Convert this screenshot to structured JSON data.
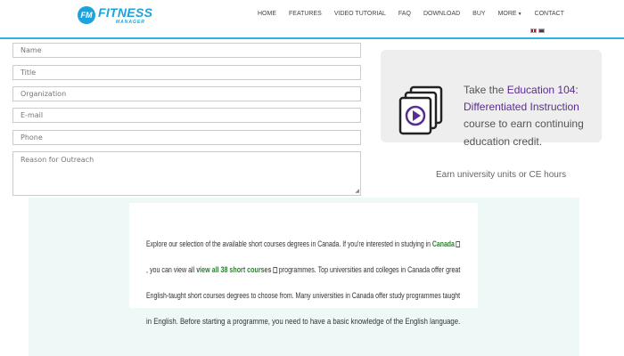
{
  "brand": {
    "badge": "FM",
    "name": "FITNESS",
    "sub": "MANAGER"
  },
  "nav": [
    {
      "label": "HOME"
    },
    {
      "label": "FEATURES"
    },
    {
      "label": "VIDEO TUTORIAL"
    },
    {
      "label": "FAQ"
    },
    {
      "label": "DOWNLOAD"
    },
    {
      "label": "BUY"
    },
    {
      "label": "MORE",
      "has_dropdown": true
    },
    {
      "label": "CONTACT"
    }
  ],
  "form": {
    "name_placeholder": "Name",
    "title_placeholder": "Title",
    "organization_placeholder": "Organization",
    "email_placeholder": "E-mail",
    "phone_placeholder": "Phone",
    "reason_placeholder": "Reason for Outreach"
  },
  "promo": {
    "text_pre": "Take the ",
    "link": "Education 104: Differentiated Instruction",
    "text_post": " course to earn continuing education credit.",
    "note": "Earn university units or CE hours"
  },
  "info": {
    "line1_pre": "Explore our selection of the available short courses degrees in Canada. If you're interested in studying in ",
    "line1_link": "Canada",
    "line2_pre": ", you can view all ",
    "line2_link": "view all 38 short courses",
    "line2_post": " programmes. Top universities and colleges in Canada offer great",
    "line3": "English-taught short courses degrees to choose from. Many universities in Canada offer study programmes taught",
    "line4": "in English. Before starting a programme, you need to have a basic knowledge of the English language."
  },
  "colors": {
    "accent": "#2bb3e6",
    "brand": "#1aa3dc",
    "promo_link": "#5a2d91",
    "info_link": "#2e7d32",
    "info_bg": "#eef8f7"
  }
}
